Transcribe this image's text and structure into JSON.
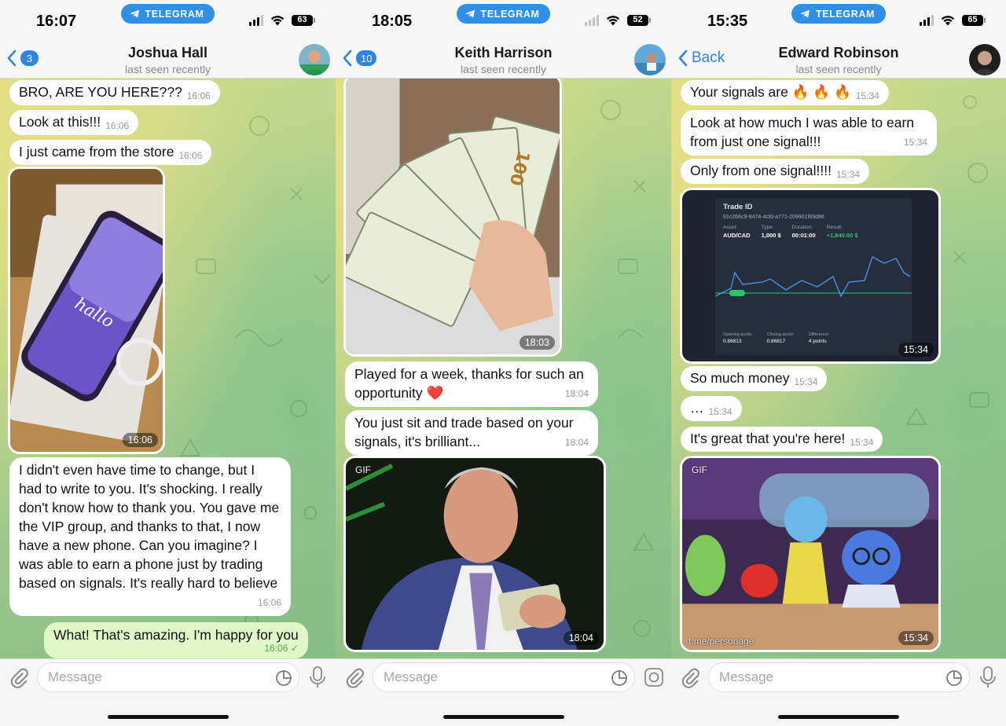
{
  "app_badge": "TELEGRAM",
  "colors": {
    "accent": "#2f84e0",
    "outgoing_bubble": "#e0f8c6",
    "incoming_bubble": "#ffffff",
    "badge_pill": "#2f90e8"
  },
  "input_placeholder": "Message",
  "panels": [
    {
      "time": "16:07",
      "battery": "63",
      "back_label": "3",
      "name": "Joshua Hall",
      "status": "last seen recently",
      "messages": [
        {
          "text": "BRO, ARE YOU HERE???",
          "time": "16:06"
        },
        {
          "text": "Look at this!!!",
          "time": "16:06"
        },
        {
          "text": "I just came from the store",
          "time": "16:06"
        },
        {
          "media": "photo",
          "subject": "new purple phone in open box",
          "time": "16:06"
        },
        {
          "text": "I didn't even have time to change, but I had to write to you. It's shocking. I really don't know how to thank you. You gave me the VIP group, and thanks to that, I now have a new phone. Can you imagine? I was able to earn a phone just by trading based on signals. It's really hard to believe",
          "time": "16:06"
        },
        {
          "text": "What! That's amazing. I'm happy for you",
          "time": "16:06 ✓",
          "outgoing": true
        }
      ]
    },
    {
      "time": "18:05",
      "battery": "52",
      "back_label": "10",
      "name": "Keith Harrison",
      "status": "last seen recently",
      "messages": [
        {
          "media": "photo",
          "subject": "hand holding fan of 100 dollar bills",
          "time": "18:03"
        },
        {
          "text": "Played for a week, thanks for such an opportunity ❤️",
          "time": "18:04"
        },
        {
          "text": "You just sit and trade based on your signals, it's brilliant...",
          "time": "18:04"
        },
        {
          "media": "gif",
          "label": "GIF",
          "subject": "man in suit holding money",
          "time": "18:04"
        }
      ]
    },
    {
      "time": "15:35",
      "battery": "65",
      "back_label": "Back",
      "name": "Edward Robinson",
      "status": "last seen recently",
      "messages": [
        {
          "text": "Your signals are 🔥 🔥 🔥",
          "time": "15:34"
        },
        {
          "text": "Look at how much I was able to earn from just one signal!!!",
          "time": "15:34"
        },
        {
          "text": "Only from one signal!!!!",
          "time": "15:34"
        },
        {
          "media": "screenshot",
          "time": "15:34",
          "trade": {
            "title": "Trade ID",
            "id": "91c266c9-8474-4cfd-a771-209901f69d86",
            "asset_label": "Asset:",
            "asset": "AUD/CAD",
            "type_label": "Type:",
            "type": "1,000 $",
            "duration_label": "Duration:",
            "duration": "00:01:00",
            "result_label": "Result:",
            "result": "+1,840.00 $",
            "open_label": "Opening quote:",
            "open": "0.86813",
            "close_label": "Closing quote:",
            "close": "0.86817",
            "diff_label": "Difference:",
            "diff": "4 points"
          }
        },
        {
          "text": "So much money",
          "time": "15:34"
        },
        {
          "text": "…",
          "time": "15:34"
        },
        {
          "text": "It's great that you're here!",
          "time": "15:34"
        },
        {
          "media": "gif",
          "label": "GIF",
          "subject": "animated characters cheering",
          "caption": "t.me/personage",
          "time": "15:34"
        }
      ]
    }
  ]
}
